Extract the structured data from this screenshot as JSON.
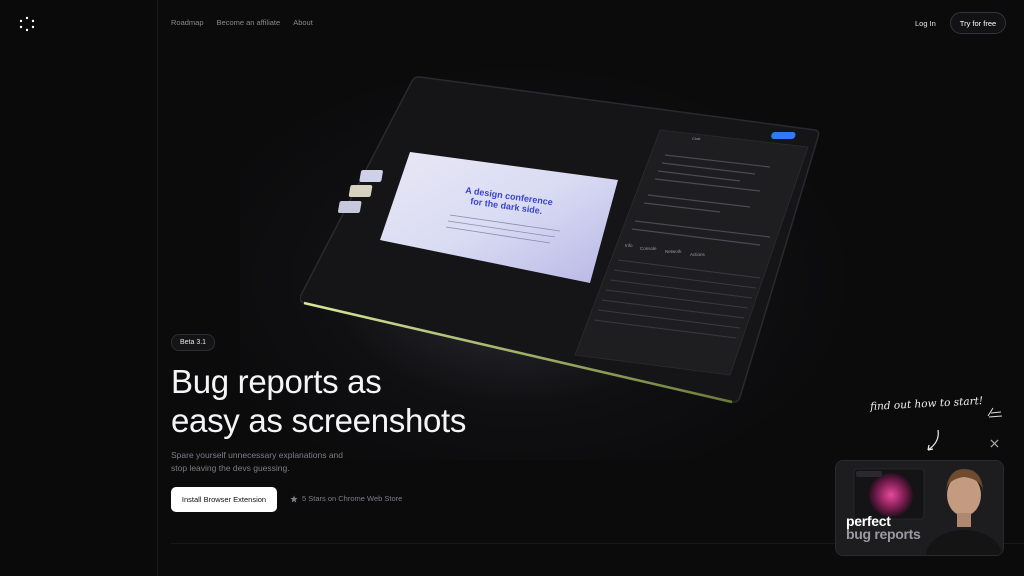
{
  "nav": {
    "items": [
      "Roadmap",
      "Become an affiliate",
      "About"
    ],
    "login": "Log In",
    "try": "Try for free"
  },
  "hero": {
    "badge": "Beta 3.1",
    "headline_line1": "Bug reports as",
    "headline_line2": "easy as screenshots",
    "sub_line1": "Spare yourself unnecessary explanations and",
    "sub_line2": "stop leaving the devs guessing.",
    "install": "Install Browser Extension",
    "stars": "5 Stars on Chrome Web Store"
  },
  "promo": {
    "callout": "find out how to start!",
    "video_text_1": "perfect",
    "video_text_2": "bug reports"
  },
  "device_screen": {
    "headline": "A design conference for the dark side.",
    "tabs": [
      "Info",
      "Console",
      "Network",
      "Actions"
    ],
    "panel_title": "Chat"
  },
  "colors": {
    "accent": "#2f7bf5",
    "background": "#0b0b0c"
  }
}
